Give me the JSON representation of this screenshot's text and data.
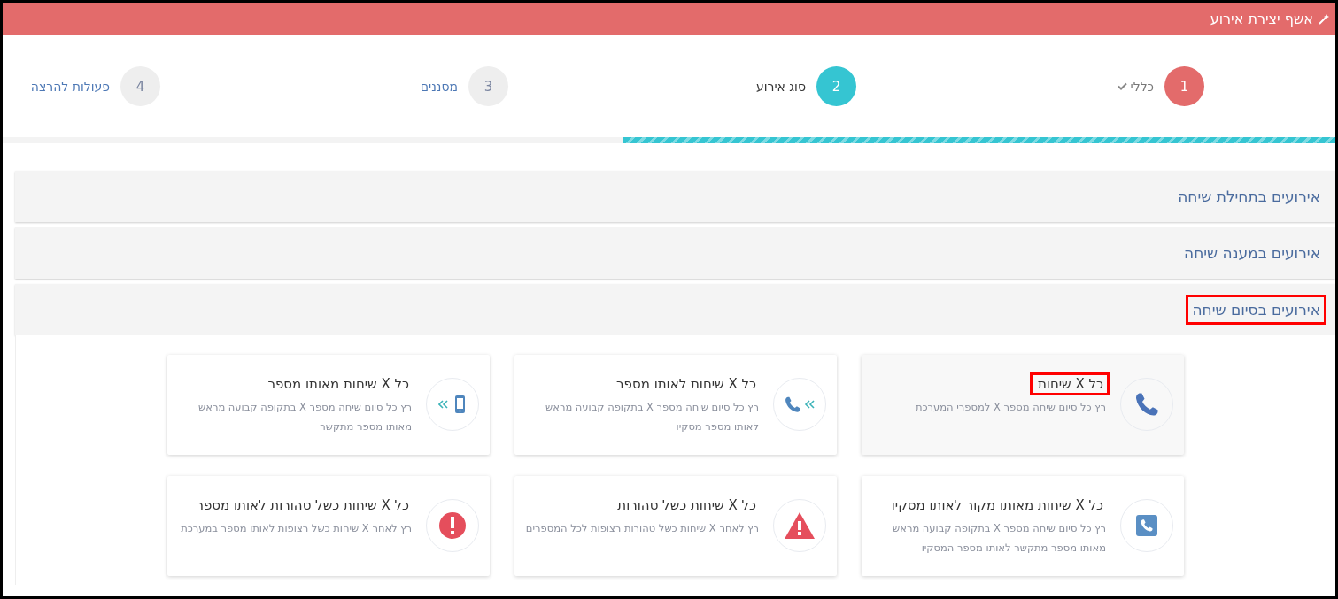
{
  "window": {
    "title": "אשף יצירת אירוע"
  },
  "steps": [
    {
      "number": "1",
      "label": "כללי",
      "completed": true,
      "selected": false
    },
    {
      "number": "2",
      "label": "סוג אירוע",
      "completed": false,
      "selected": true
    },
    {
      "number": "3",
      "label": "מסננים",
      "completed": false,
      "selected": false
    },
    {
      "number": "4",
      "label": "פעולות להרצה",
      "completed": false,
      "selected": false
    }
  ],
  "progress": {
    "level": 0.535
  },
  "panels": [
    {
      "title": "אירועים בתחילת שיחה",
      "expanded": false,
      "highlighted": false
    },
    {
      "title": "אירועים במענה שיחה",
      "expanded": false,
      "highlighted": false
    },
    {
      "title": "אירועים בסיום שיחה",
      "expanded": true,
      "highlighted": true,
      "cards": [
        {
          "kind": "phone",
          "title": "כל X שיחות",
          "description": "רץ כל סיום שיחה מספר X למספרי המערכת",
          "selected": true,
          "highlighted": true
        },
        {
          "kind": "phone-forward",
          "title": "כל X שיחות לאותו מספר",
          "description": "רץ כל סיום שיחה מספר X בתקופה קבועה מראש לאותו מספר מסקיו",
          "selected": false,
          "highlighted": false
        },
        {
          "kind": "mobile-forward",
          "title": "כל X שיחות מאותו מספר",
          "description": "רץ כל סיום שיחה מספר X בתקופה קבועה מראש מאותו מספר מתקשר",
          "selected": false,
          "highlighted": false
        },
        {
          "kind": "phone-square",
          "title": "כל X שיחות מאותו מקור לאותו מסקיו",
          "description": "רץ כל סיום שיחה מספר X בתקופה קבועה מראש מאותו מספר מתקשר לאותו מספר המסקיו",
          "selected": false,
          "highlighted": false
        },
        {
          "kind": "warning",
          "title": "כל X שיחות כשל טהורות",
          "description": "רץ לאחר X שיחות כשל טהורות רצופות לכל המספרים",
          "selected": false,
          "highlighted": false
        },
        {
          "kind": "error",
          "title": "כל X שיחות כשל טהורות לאותו מספר",
          "description": "רץ לאחר X שיחות כשל רצופות לאותו מספר במערכת",
          "selected": false,
          "highlighted": false
        }
      ]
    }
  ]
}
